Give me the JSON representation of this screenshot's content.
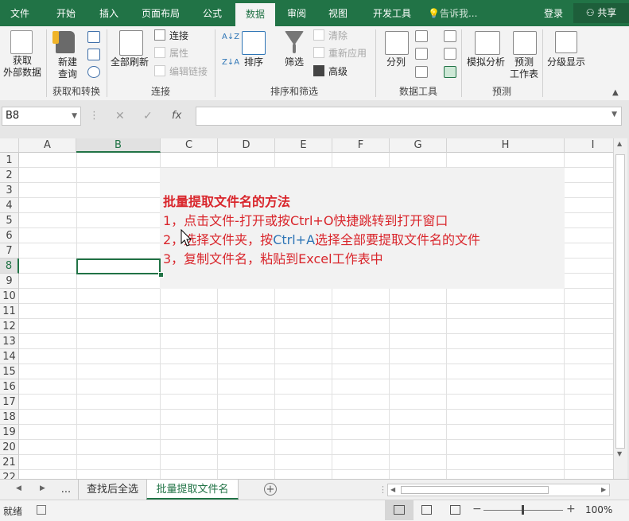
{
  "tabs": [
    {
      "label": "文件",
      "active": false
    },
    {
      "label": "开始",
      "active": false
    },
    {
      "label": "插入",
      "active": false
    },
    {
      "label": "页面布局",
      "active": false
    },
    {
      "label": "公式",
      "active": false
    },
    {
      "label": "数据",
      "active": true
    },
    {
      "label": "审阅",
      "active": false
    },
    {
      "label": "视图",
      "active": false
    },
    {
      "label": "开发工具",
      "active": false
    }
  ],
  "tellme": "告诉我...",
  "login": "登录",
  "share": "共享",
  "ribbon": {
    "get_data": "获取\n外部数据",
    "new_query": "新建\n查询",
    "group_get": "获取和转换",
    "refresh_all": "全部刷新",
    "connections": "连接",
    "properties": "属性",
    "edit_links": "编辑链接",
    "group_conn": "连接",
    "sort": "排序",
    "filter": "筛选",
    "clear": "清除",
    "reapply": "重新应用",
    "advanced": "高级",
    "group_sort": "排序和筛选",
    "text_to_cols": "分列",
    "group_tools": "数据工具",
    "what_if": "模拟分析",
    "forecast": "预测\n工作表",
    "group_forecast": "预测",
    "outline": "分级显示",
    "az": "A↓Z",
    "za": "Z↓A"
  },
  "formula": {
    "namebox": "B8",
    "cancel": "✕",
    "enter": "✓",
    "fx": "fx",
    "value": ""
  },
  "columns": [
    "A",
    "B",
    "C",
    "D",
    "E",
    "F",
    "G",
    "H",
    "I"
  ],
  "rows": [
    "1",
    "2",
    "3",
    "4",
    "5",
    "6",
    "7",
    "8",
    "9",
    "10",
    "11",
    "12",
    "13",
    "14",
    "15",
    "16",
    "17",
    "18",
    "19",
    "20",
    "21",
    "22"
  ],
  "content": {
    "title": "批量提取文件名的方法",
    "line1": "1，点击文件-打开或按Ctrl+O快捷跳转到打开窗口",
    "line2_a": "2，选择文件夹，按",
    "line2_b": "Ctrl+A",
    "line2_c": "选择全部要提取文件名的文件",
    "line3": "3，复制文件名，粘贴到Excel工作表中"
  },
  "sheets": {
    "ellipsis": "...",
    "tab1": "查找后全选",
    "tab2": "批量提取文件名",
    "add": "+"
  },
  "status": {
    "ready": "就绪",
    "zoom": "100%",
    "minus": "−",
    "plus": "+"
  },
  "colors": {
    "brand": "#217346",
    "red": "#d9262c",
    "blue": "#2e75b6"
  }
}
